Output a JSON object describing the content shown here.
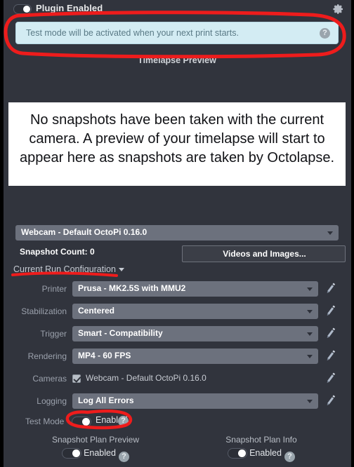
{
  "header": {
    "plugin_toggle_label": "Plugin Enabled",
    "plugin_toggle_state": "on",
    "settings_icon": "gear-icon"
  },
  "alert": {
    "message": "Test mode will be activated when your next print starts.",
    "help_glyph": "?",
    "bg_color": "#d3ecf3",
    "text_color": "#5a7a86"
  },
  "preview": {
    "title": "Timelapse Preview",
    "empty_message": "No snapshots have been taken with the current camera. A preview of your timelapse will start to appear here as snapshots are taken by Octolapse."
  },
  "camera": {
    "selected": "Webcam - Default OctoPi 0.16.0"
  },
  "snapshot": {
    "count_label": "Snapshot Count:  0",
    "videos_button": "Videos and Images..."
  },
  "config": {
    "section_label": "Current Run Configuration",
    "rows": [
      {
        "label": "Printer",
        "value": "Prusa - MK2.5S with MMU2",
        "type": "select"
      },
      {
        "label": "Stabilization",
        "value": "Centered",
        "type": "select"
      },
      {
        "label": "Trigger",
        "value": "Smart - Compatibility",
        "type": "select"
      },
      {
        "label": "Rendering",
        "value": "MP4 - 60 FPS",
        "type": "select"
      },
      {
        "label": "Cameras",
        "value": "Webcam - Default OctoPi 0.16.0",
        "type": "checkbox",
        "checked": true
      },
      {
        "label": "Logging",
        "value": "Log All Errors",
        "type": "select"
      }
    ]
  },
  "test_mode": {
    "label": "Test Mode",
    "state_text": "Enabled",
    "help_glyph": "?"
  },
  "bottom_toggles": [
    {
      "caption": "Snapshot Plan Preview",
      "state_text": "Enabled",
      "help_glyph": "?"
    },
    {
      "caption": "Snapshot Plan Info",
      "state_text": "Enabled",
      "help_glyph": "?"
    }
  ],
  "annotation": {
    "color": "#ee1c1c",
    "shapes": "ellipse-around-alert, underline-current-run-configuration, ellipse-around-test-mode-toggle"
  }
}
